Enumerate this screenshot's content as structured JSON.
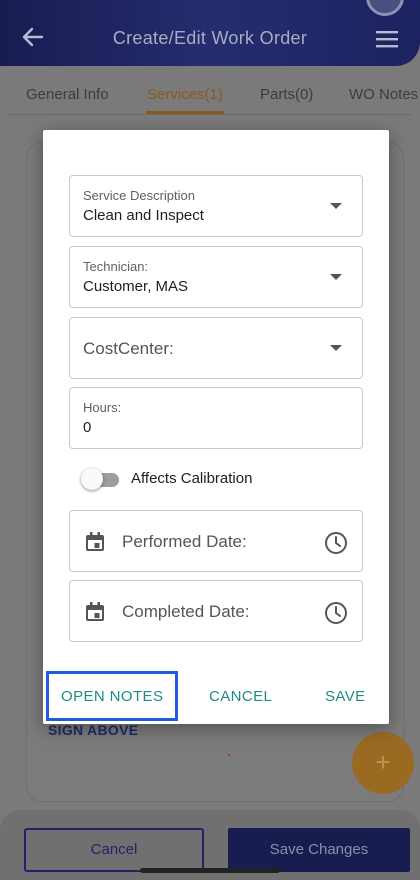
{
  "header": {
    "title": "Create/Edit Work Order"
  },
  "tabs": [
    {
      "label": "General Info"
    },
    {
      "label": "Services(1)"
    },
    {
      "label": "Parts(0)"
    },
    {
      "label": "WO Notes"
    }
  ],
  "dialog": {
    "service_description": {
      "label": "Service Description",
      "value": "Clean and Inspect"
    },
    "technician": {
      "label": "Technician:",
      "value": "Customer, MAS"
    },
    "cost_center": {
      "placeholder": "CostCenter:"
    },
    "hours": {
      "label": "Hours:",
      "value": "0"
    },
    "affects_calibration": {
      "label": "Affects Calibration",
      "on": false
    },
    "performed_date": {
      "label": "Performed Date:"
    },
    "completed_date": {
      "label": "Completed Date:"
    },
    "actions": {
      "open_notes": "OPEN NOTES",
      "cancel": "CANCEL",
      "save": "SAVE"
    }
  },
  "background": {
    "sign_above": "SIGN ABOVE",
    "fab": "+"
  },
  "bottom_bar": {
    "cancel": "Cancel",
    "save_changes": "Save Changes"
  },
  "colors": {
    "header": "#262d6e",
    "accent": "#1e8c86",
    "highlight": "#1d5fd6",
    "fab": "#e29a2f"
  },
  "icons": [
    "back-arrow-icon",
    "hamburger-menu-icon",
    "dropdown-caret-icon",
    "calendar-icon",
    "clock-icon",
    "plus-icon"
  ]
}
